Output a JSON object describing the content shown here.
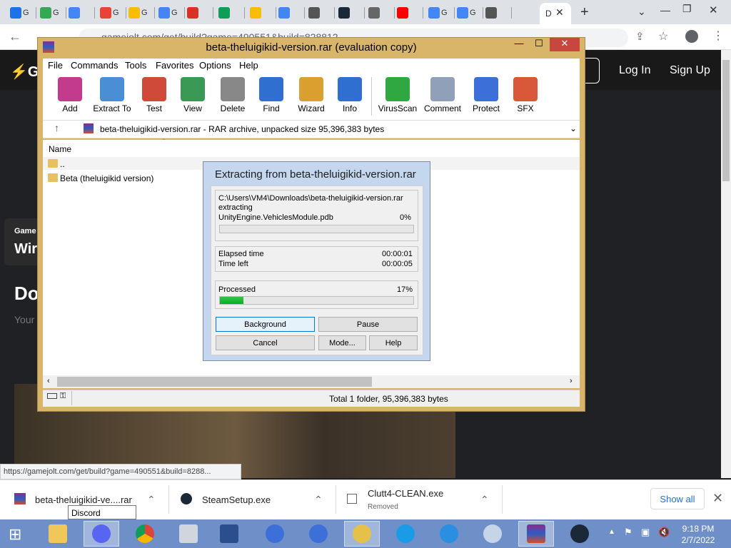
{
  "browser": {
    "tabs": [
      "G",
      "G",
      "",
      "G",
      "G",
      "G",
      "",
      "",
      "",
      "",
      "",
      "",
      "",
      "",
      "G",
      "G",
      "",
      "D"
    ],
    "active_tab_label": "D",
    "new_tab": "+",
    "url": "gamejolt.com/get/build?game=490551&build=828812",
    "status_url": "https://gamejolt.com/get/build?game=490551&build=8288..."
  },
  "gamejolt": {
    "login": "Log In",
    "signup": "Sign Up",
    "card_small": "Game",
    "card_big": "Wir",
    "heading": "Do",
    "subtext": "Your"
  },
  "winrar": {
    "title": "beta-theluigikid-version.rar (evaluation copy)",
    "menu": [
      "File",
      "Commands",
      "Tools",
      "Favorites",
      "Options",
      "Help"
    ],
    "toolbar": [
      "Add",
      "Extract To",
      "Test",
      "View",
      "Delete",
      "Find",
      "Wizard",
      "Info",
      "VirusScan",
      "Comment",
      "Protect",
      "SFX"
    ],
    "path": "beta-theluigikid-version.rar - RAR archive, unpacked size 95,396,383 bytes",
    "column_name": "Name",
    "files": [
      "..",
      "Beta (theluigikid version)"
    ],
    "status": "Total 1 folder, 95,396,383 bytes"
  },
  "extract": {
    "title": "Extracting from beta-theluigikid-version.rar",
    "path_line": "C:\\Users\\VM4\\Downloads\\beta-theluigikid-version.rar",
    "action": "extracting",
    "file": "UnityEngine.VehiclesModule.pdb",
    "file_pct": "0%",
    "file_progress": 0,
    "elapsed_label": "Elapsed time",
    "elapsed": "00:00:01",
    "left_label": "Time left",
    "left": "00:00:05",
    "processed_label": "Processed",
    "processed_pct": "17%",
    "processed_progress": 0.12,
    "btn_background": "Background",
    "btn_pause": "Pause",
    "btn_cancel": "Cancel",
    "btn_mode": "Mode...",
    "btn_help": "Help"
  },
  "downloads": {
    "items": [
      {
        "name": "beta-theluigikid-ve....rar",
        "sub": ""
      },
      {
        "name": "SteamSetup.exe",
        "sub": ""
      },
      {
        "name": "Clutt4-CLEAN.exe",
        "sub": "Removed"
      }
    ],
    "show_all": "Show all",
    "tooltip": "Discord Updater"
  },
  "taskbar": {
    "time": "9:18 PM",
    "date": "2/7/2022"
  },
  "colors": {
    "rar_frame": "#d9b56a",
    "progress_green": "#06b025",
    "taskbar": "#6e8fc7",
    "link_blue": "#1a73e8"
  }
}
